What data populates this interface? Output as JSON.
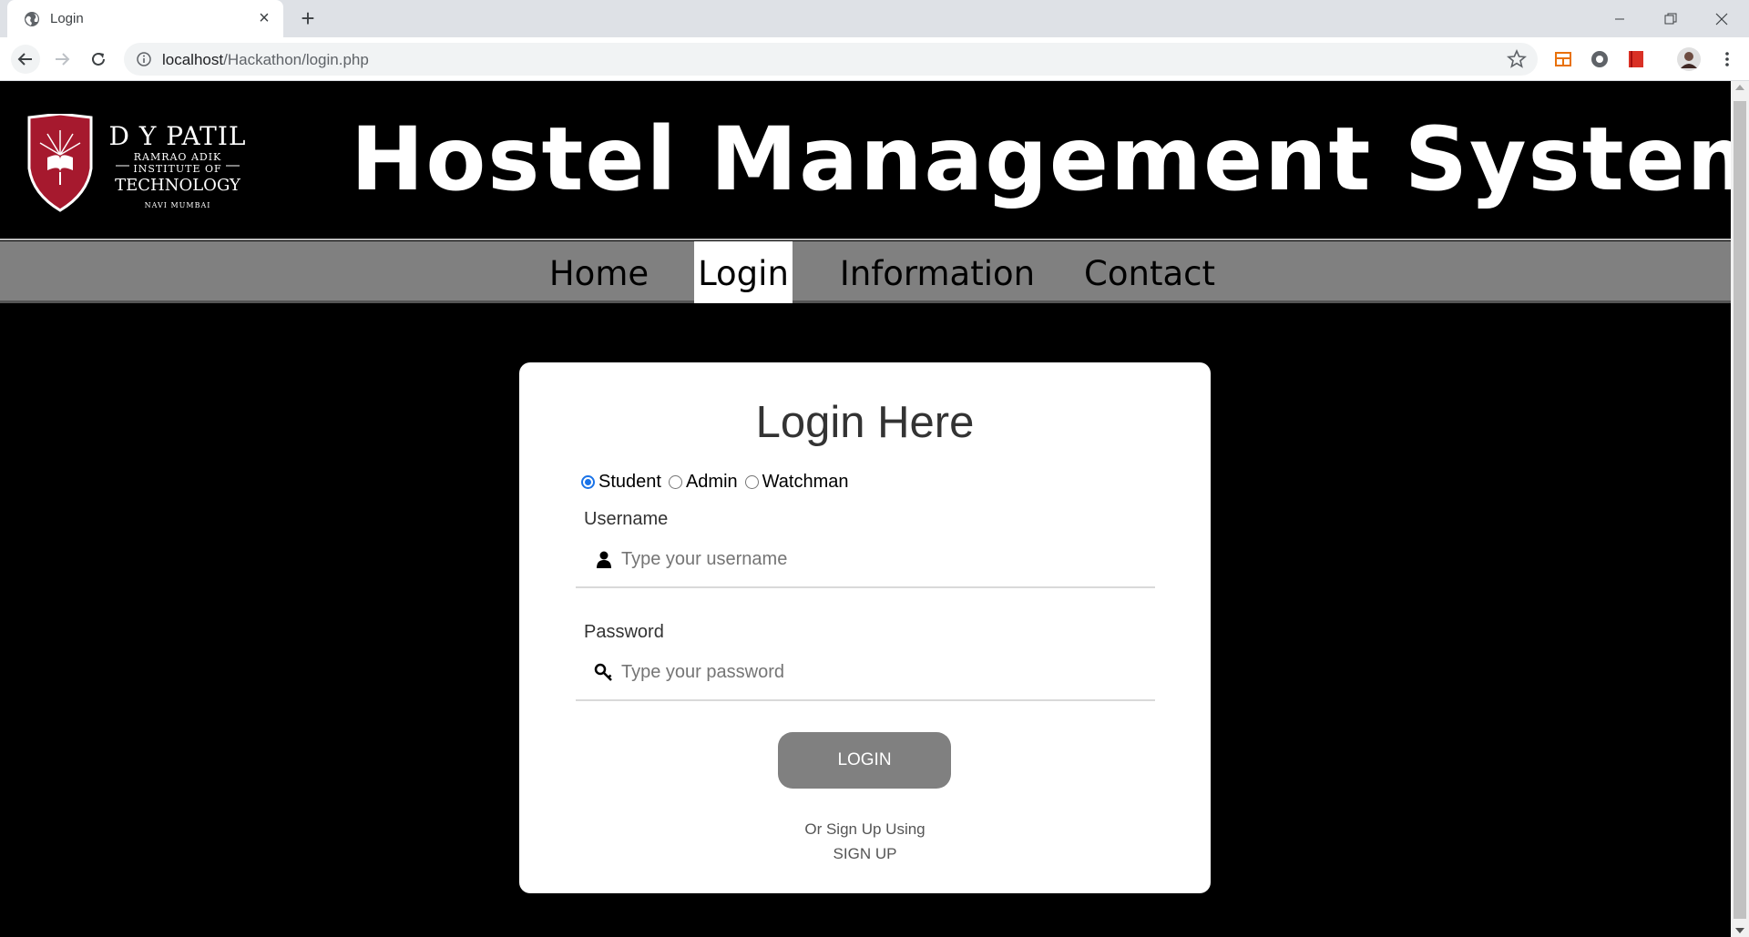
{
  "browser": {
    "tab_title": "Login",
    "url_host": "localhost",
    "url_path": "/Hackathon/login.php"
  },
  "logo": {
    "line1": "D Y PATIL",
    "line2": "RAMRAO ADIK",
    "line3": "INSTITUTE OF",
    "line4": "TECHNOLOGY",
    "line5": "NAVI MUMBAI",
    "shield_color": "#a6192e"
  },
  "site_title": "Hostel Management System",
  "nav": {
    "items": [
      {
        "label": "Home"
      },
      {
        "label": "Login"
      },
      {
        "label": "Information"
      },
      {
        "label": "Contact"
      }
    ],
    "active": "Login"
  },
  "login": {
    "title": "Login Here",
    "roles": [
      {
        "label": "Student",
        "checked": true
      },
      {
        "label": "Admin",
        "checked": false
      },
      {
        "label": "Watchman",
        "checked": false
      }
    ],
    "username_label": "Username",
    "username_placeholder": "Type your username",
    "password_label": "Password",
    "password_placeholder": "Type your password",
    "button_label": "LOGIN",
    "alt_text": "Or Sign Up Using",
    "signup_label": "SIGN UP"
  },
  "colors": {
    "page_bg": "#000000",
    "navbar_bg": "#808080",
    "button_bg": "#808080",
    "radio_accent": "#1a73e8"
  }
}
